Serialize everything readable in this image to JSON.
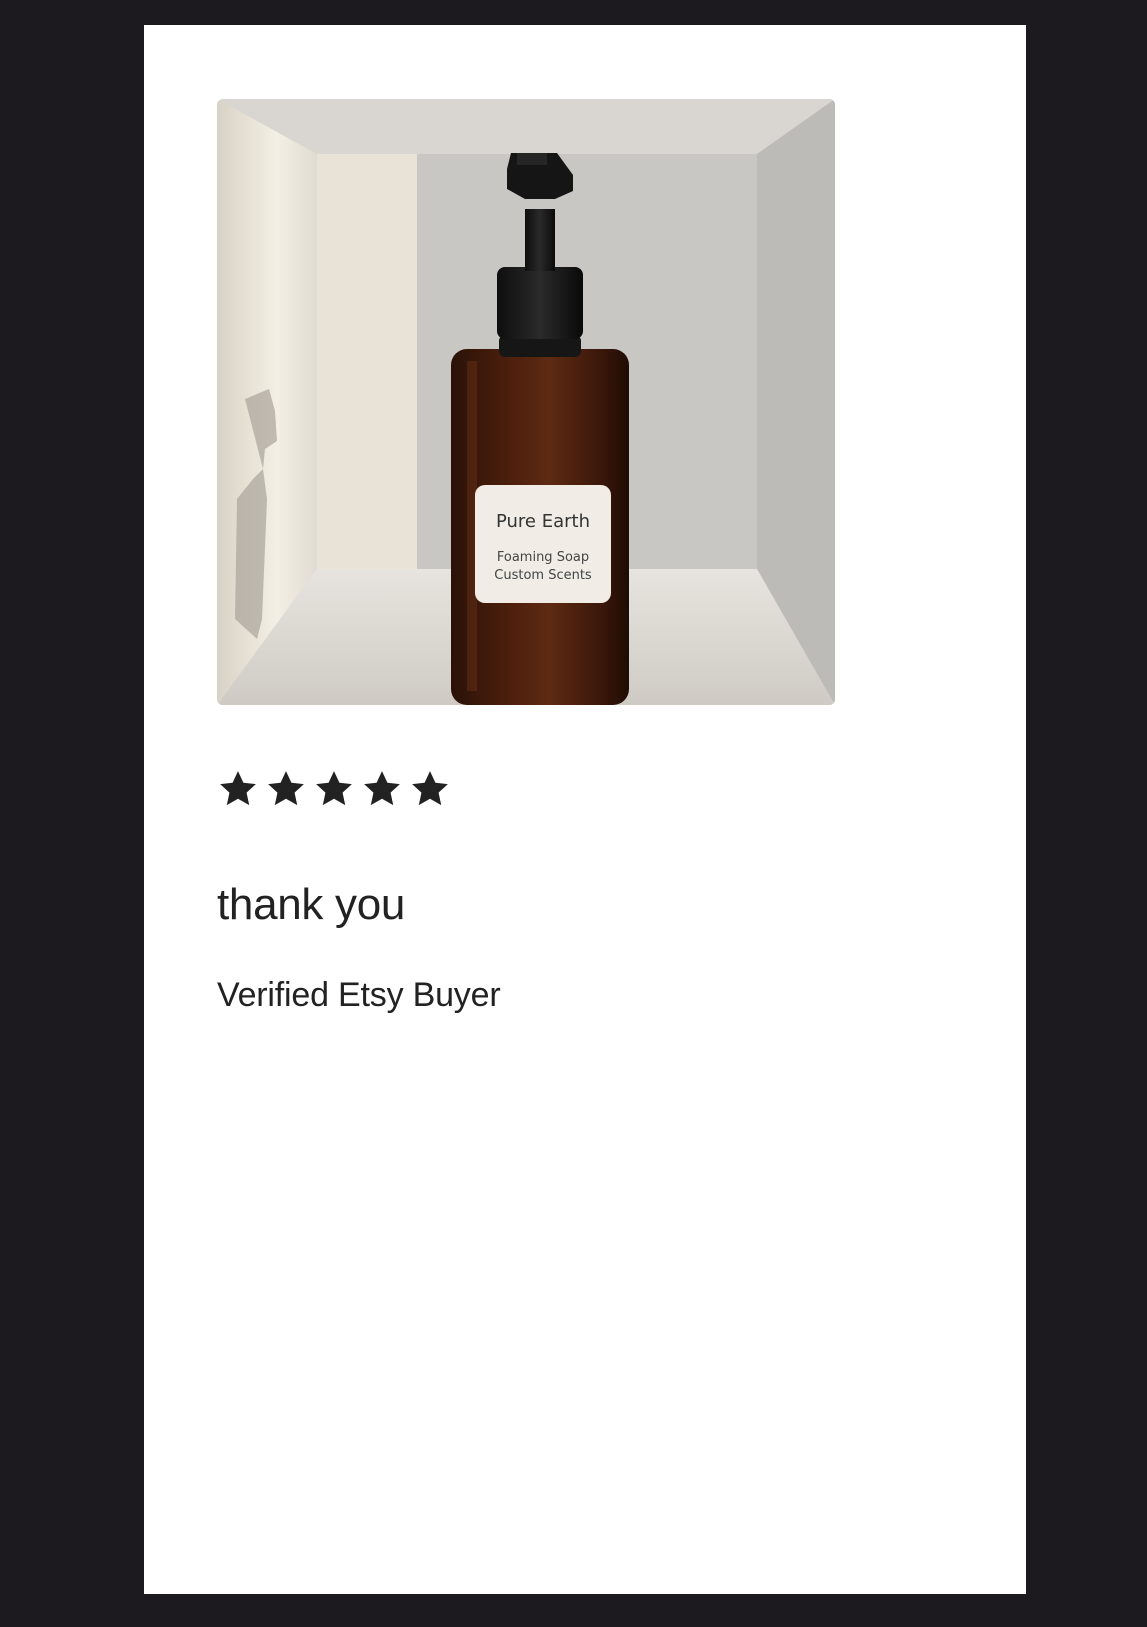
{
  "review": {
    "photo": {
      "label_brand": "Pure Earth",
      "label_line1": "Foaming Soap",
      "label_line2": "Custom Scents"
    },
    "rating": 5,
    "rating_max": 5,
    "title": "thank you",
    "reviewer": "Verified Etsy Buyer"
  },
  "colors": {
    "page_background": "#1c1a1f",
    "card_background": "#ffffff",
    "text": "#222222",
    "star": "#222222"
  },
  "icons": {
    "star": "star-icon"
  }
}
